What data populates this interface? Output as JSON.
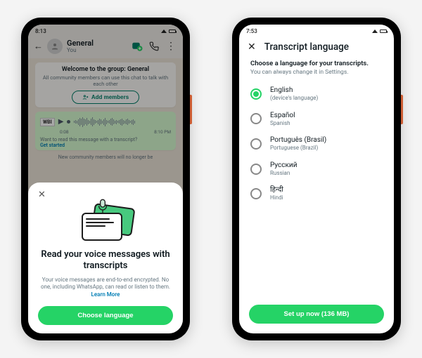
{
  "phone1": {
    "status_time": "8:13",
    "chat": {
      "title": "General",
      "subtitle": "You",
      "banner_title": "Welcome to the group: General",
      "banner_sub": "All community members can use this chat to talk with each other",
      "add_members": "Add members",
      "vm_time": "0:08",
      "vm_stamp": "8:10 PM",
      "vm_hint": "Want to read this message with a transcript?",
      "vm_link": "Get started",
      "sys_note": "New community members will no longer be"
    },
    "sheet": {
      "heading": "Read your voice messages with transcripts",
      "body": "Your voice messages are end-to-end encrypted. No one, including WhatsApp, can read or listen to them.",
      "learn_more": "Learn More",
      "cta": "Choose language"
    }
  },
  "phone2": {
    "status_time": "7:53",
    "header": "Transcript language",
    "sub_title": "Choose a language for your transcripts.",
    "sub_hint": "You can always change it in Settings.",
    "langs": [
      {
        "name": "English",
        "sub": "(device's language)",
        "selected": true
      },
      {
        "name": "Español",
        "sub": "Spanish",
        "selected": false
      },
      {
        "name": "Português (Brasil)",
        "sub": "Portuguese (Brazil)",
        "selected": false
      },
      {
        "name": "Русский",
        "sub": "Russian",
        "selected": false
      },
      {
        "name": "हिन्दी",
        "sub": "Hindi",
        "selected": false
      }
    ],
    "cta": "Set up now (136 MB)"
  }
}
